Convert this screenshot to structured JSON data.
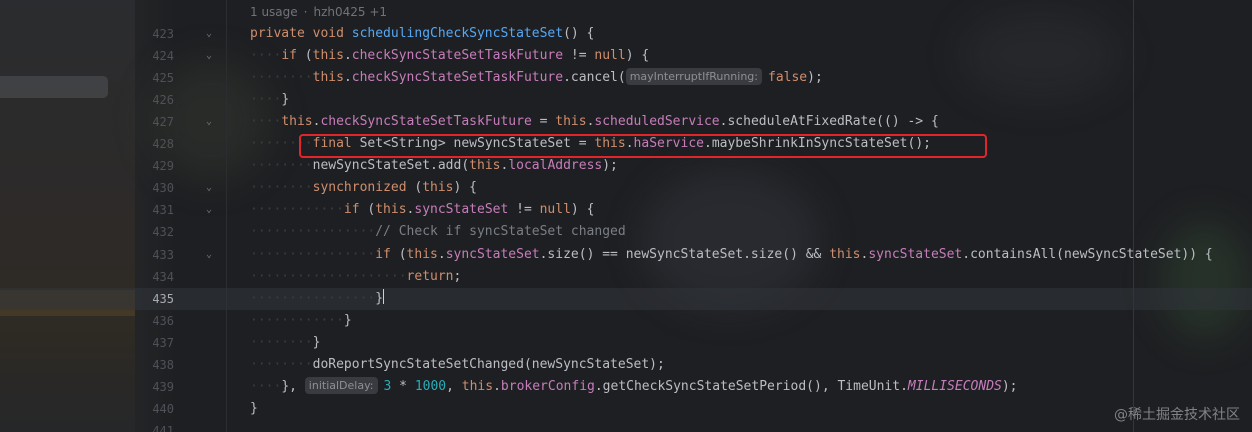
{
  "meta": {
    "usages": "1 usage",
    "author": "hzh0425 +1"
  },
  "lines": [
    {
      "n": "423",
      "fold": "⌄",
      "segments": [
        [
          "kw",
          "private void "
        ],
        [
          "fn",
          "schedulingCheckSyncStateSet"
        ],
        [
          "tag",
          "() {"
        ]
      ],
      "indent": 0
    },
    {
      "n": "424",
      "fold": "⌄",
      "segments": [
        [
          "kw",
          "if "
        ],
        [
          "tag",
          "("
        ],
        [
          "kw",
          "this"
        ],
        [
          "tag",
          "."
        ],
        [
          "fld",
          "checkSyncStateSetTaskFuture"
        ],
        [
          "tag",
          " != "
        ],
        [
          "kw",
          "null"
        ],
        [
          "tag",
          ") {"
        ]
      ],
      "indent": 1
    },
    {
      "n": "425",
      "fold": "",
      "segments": [
        [
          "kw",
          "this"
        ],
        [
          "tag",
          "."
        ],
        [
          "fld",
          "checkSyncStateSetTaskFuture"
        ],
        [
          "tag",
          ".cancel("
        ],
        [
          "hint",
          "mayInterruptIfRunning:"
        ],
        [
          "kw",
          "false"
        ],
        [
          "tag",
          ");"
        ]
      ],
      "indent": 2
    },
    {
      "n": "426",
      "fold": "",
      "segments": [
        [
          "tag",
          "}"
        ]
      ],
      "indent": 1
    },
    {
      "n": "427",
      "fold": "⌄",
      "segments": [
        [
          "kw",
          "this"
        ],
        [
          "tag",
          "."
        ],
        [
          "fld",
          "checkSyncStateSetTaskFuture"
        ],
        [
          "tag",
          " = "
        ],
        [
          "kw",
          "this"
        ],
        [
          "tag",
          "."
        ],
        [
          "fld",
          "scheduledService"
        ],
        [
          "tag",
          ".scheduleAtFixedRate(() -> {"
        ]
      ],
      "indent": 1
    },
    {
      "n": "428",
      "fold": "",
      "segments": [
        [
          "kw",
          "final "
        ],
        [
          "tag",
          "Set<String> newSyncStateSet = "
        ],
        [
          "kw",
          "this"
        ],
        [
          "tag",
          "."
        ],
        [
          "fld",
          "haService"
        ],
        [
          "tag",
          ".maybeShrinkInSyncStateSet();"
        ]
      ],
      "indent": 2
    },
    {
      "n": "429",
      "fold": "",
      "segments": [
        [
          "tag",
          "newSyncStateSet.add("
        ],
        [
          "kw",
          "this"
        ],
        [
          "tag",
          "."
        ],
        [
          "fld",
          "localAddress"
        ],
        [
          "tag",
          ");"
        ]
      ],
      "indent": 2
    },
    {
      "n": "430",
      "fold": "⌄",
      "segments": [
        [
          "kw",
          "synchronized "
        ],
        [
          "tag",
          "("
        ],
        [
          "kw",
          "this"
        ],
        [
          "tag",
          ") {"
        ]
      ],
      "indent": 2
    },
    {
      "n": "431",
      "fold": "⌄",
      "segments": [
        [
          "kw",
          "if "
        ],
        [
          "tag",
          "("
        ],
        [
          "kw",
          "this"
        ],
        [
          "tag",
          "."
        ],
        [
          "fld",
          "syncStateSet"
        ],
        [
          "tag",
          " != "
        ],
        [
          "kw",
          "null"
        ],
        [
          "tag",
          ") {"
        ]
      ],
      "indent": 3
    },
    {
      "n": "432",
      "fold": "",
      "segments": [
        [
          "cm",
          "// Check if syncStateSet changed"
        ]
      ],
      "indent": 4
    },
    {
      "n": "433",
      "fold": "⌄",
      "segments": [
        [
          "kw",
          "if "
        ],
        [
          "tag",
          "("
        ],
        [
          "kw",
          "this"
        ],
        [
          "tag",
          "."
        ],
        [
          "fld",
          "syncStateSet"
        ],
        [
          "tag",
          ".size() == newSyncStateSet.size() && "
        ],
        [
          "kw",
          "this"
        ],
        [
          "tag",
          "."
        ],
        [
          "fld",
          "syncStateSet"
        ],
        [
          "tag",
          ".containsAll(newSyncStateSet)) {"
        ]
      ],
      "indent": 4
    },
    {
      "n": "434",
      "fold": "",
      "segments": [
        [
          "kw",
          "return"
        ],
        [
          "tag",
          ";"
        ]
      ],
      "indent": 5
    },
    {
      "n": "435",
      "fold": "",
      "segments": [
        [
          "tag",
          "}"
        ]
      ],
      "indent": 4,
      "current": true
    },
    {
      "n": "436",
      "fold": "",
      "segments": [
        [
          "tag",
          "}"
        ]
      ],
      "indent": 3
    },
    {
      "n": "437",
      "fold": "",
      "segments": [
        [
          "tag",
          "}"
        ]
      ],
      "indent": 2
    },
    {
      "n": "438",
      "fold": "",
      "segments": [
        [
          "tag",
          "doReportSyncStateSetChanged(newSyncStateSet);"
        ]
      ],
      "indent": 2
    },
    {
      "n": "439",
      "fold": "",
      "segments": [
        [
          "tag",
          "}, "
        ],
        [
          "hint",
          "initialDelay:"
        ],
        [
          "num",
          "3 "
        ],
        [
          "tag",
          "* "
        ],
        [
          "num",
          "1000"
        ],
        [
          "tag",
          ", "
        ],
        [
          "kw",
          "this"
        ],
        [
          "tag",
          "."
        ],
        [
          "fld",
          "brokerConfig"
        ],
        [
          "tag",
          ".getCheckSyncStateSetPeriod(), TimeUnit."
        ],
        [
          "const",
          "MILLISECONDS"
        ],
        [
          "tag",
          ");"
        ]
      ],
      "indent": 1
    },
    {
      "n": "440",
      "fold": "",
      "segments": [
        [
          "tag",
          "}"
        ]
      ],
      "indent": 0
    },
    {
      "n": "441",
      "fold": "",
      "segments": [],
      "indent": 0
    }
  ],
  "watermark": "@稀土掘金技术社区",
  "colors": {
    "background": "#1e1f22",
    "keyword": "#cf8e6d",
    "method": "#56a8f5",
    "field": "#c77dbb",
    "number": "#2aacb8",
    "comment": "#7a7e85",
    "highlight_box": "#e1262b"
  },
  "highlighted_line": "428",
  "current_line": "435"
}
